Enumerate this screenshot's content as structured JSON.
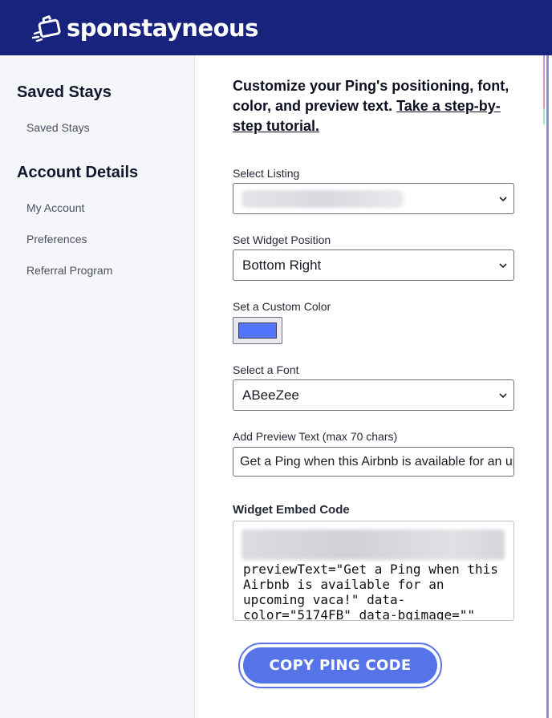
{
  "header": {
    "brand": "sponstayneous"
  },
  "sidebar": {
    "sections": [
      {
        "title": "Saved Stays",
        "links": [
          "Saved Stays"
        ]
      },
      {
        "title": "Account Details",
        "links": [
          "My Account",
          "Preferences",
          "Referral Program"
        ]
      }
    ]
  },
  "main": {
    "intro_text": "Customize your Ping's positioning, font, color, and preview text.",
    "intro_link": "Take a step-by-step tutorial.",
    "listing": {
      "label": "Select Listing",
      "value": ""
    },
    "position": {
      "label": "Set Widget Position",
      "value": "Bottom Right"
    },
    "color": {
      "label": "Set a Custom Color",
      "value": "#5174FB"
    },
    "font": {
      "label": "Select a Font",
      "value": "ABeeZee"
    },
    "preview": {
      "label": "Add Preview Text (max 70 chars)",
      "value": "Get a Ping when this Airbnb is available for an upcoming vaca!"
    },
    "embed": {
      "label": "Widget Embed Code",
      "code": "previewText=\"Get a Ping when this\nAirbnb is available for an\nupcoming vaca!\" data-\ncolor=\"5174FB\" data-bgimage=\"\""
    },
    "copy_button": "COPY PING CODE"
  },
  "icons": {
    "logo": "luggage-logo-icon",
    "chevron": "chevron-down-icon"
  }
}
